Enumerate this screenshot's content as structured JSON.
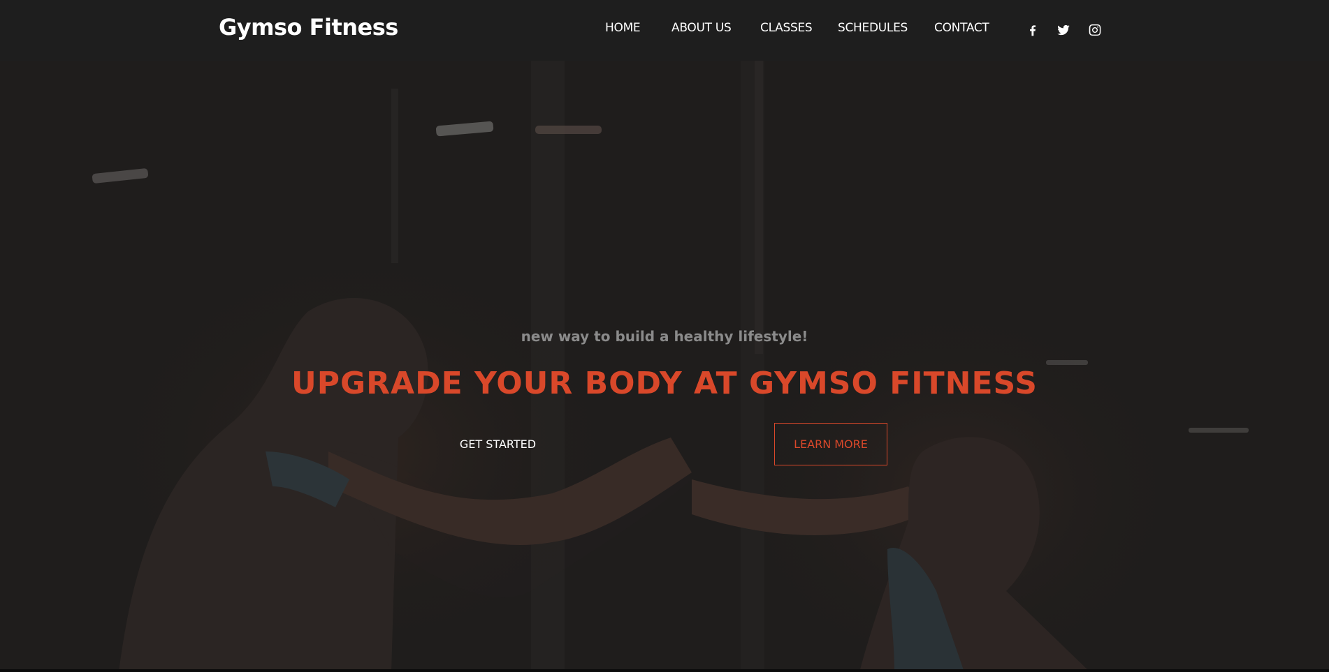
{
  "navbar": {
    "brand": "Gymso Fitness",
    "links": [
      "HOME",
      "ABOUT US",
      "CLASSES",
      "SCHEDULES",
      "CONTACT"
    ],
    "social_icons": [
      "facebook-icon",
      "twitter-icon",
      "instagram-icon"
    ]
  },
  "hero": {
    "subtitle": "new way to build a healthy lifestyle!",
    "headline": "UPGRADE YOUR BODY AT GYMSO FITNESS",
    "primary_button": "GET STARTED",
    "secondary_button": "LEARN MORE"
  },
  "colors": {
    "accent": "#d9482a",
    "navbar_bg": "#1e1e1e",
    "hero_bg": "#1f1d1c",
    "subtitle": "#8b8b8b"
  }
}
